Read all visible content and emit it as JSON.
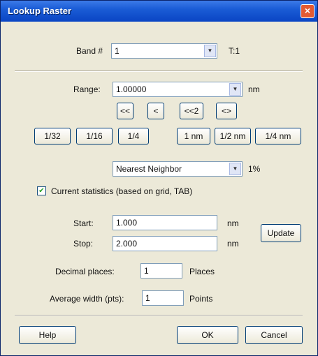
{
  "window": {
    "title": "Lookup Raster",
    "close_glyph": "×"
  },
  "top": {
    "label": "Band #",
    "value": "1",
    "suffix": "T:1"
  },
  "range": {
    "label": "Range:",
    "value": "1.00000",
    "unit": "nm",
    "step_buttons": [
      "<<",
      "<",
      "<<2",
      "<>"
    ],
    "preset_buttons": [
      "1/32",
      "1/16",
      "1/4",
      "1 nm",
      "1/2 nm",
      "1/4 nm"
    ]
  },
  "method": {
    "value": "Nearest Neighbor",
    "suffix": "1%"
  },
  "checkbox": {
    "label": "Current statistics (based on grid, TAB)",
    "checked": true
  },
  "fields": {
    "start_label": "Start:",
    "start_value": "1.000",
    "start_unit": "nm",
    "stop_label": "Stop:",
    "stop_value": "2.000",
    "stop_unit": "nm",
    "update_button": "Update"
  },
  "decimal": {
    "label": "Decimal places:",
    "value": "1",
    "suffix": "Places"
  },
  "average": {
    "label": "Average width (pts):",
    "value": "1",
    "suffix": "Points"
  },
  "footer": {
    "help": "Help",
    "ok": "OK",
    "cancel": "Cancel"
  }
}
